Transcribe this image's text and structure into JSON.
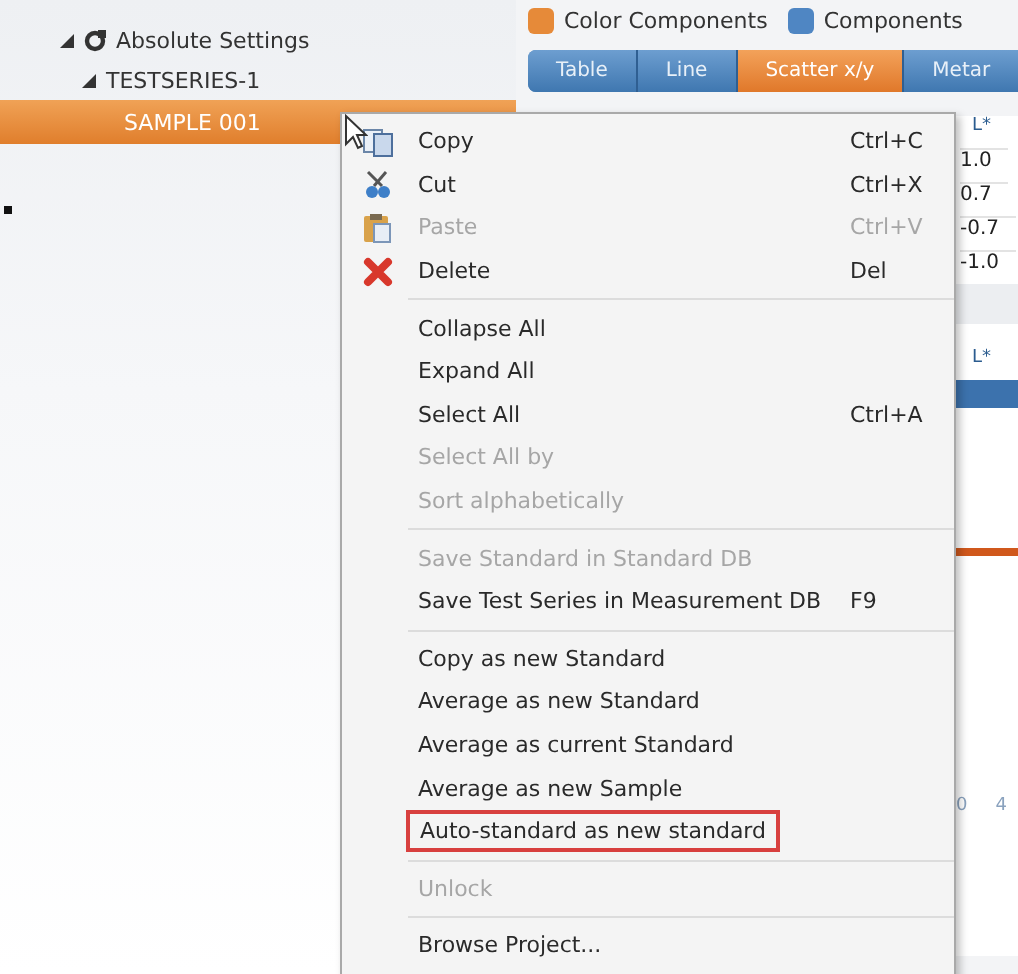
{
  "tree": [
    {
      "label": "Absolute Settings",
      "expanded": true,
      "selected": false,
      "children": [
        {
          "label": "TESTSERIES-1",
          "expanded": true,
          "selected": false,
          "children": [
            {
              "label": "SAMPLE 001",
              "selected": true
            }
          ]
        }
      ]
    }
  ],
  "options": [
    {
      "label": "Color Components",
      "checked": true
    },
    {
      "label": "Components",
      "checked": false
    }
  ],
  "view_tabs": [
    {
      "label": "Table",
      "selected": false
    },
    {
      "label": "Line",
      "selected": false
    },
    {
      "label": "Scatter x/y",
      "selected": true
    },
    {
      "label": "Metar",
      "selected": false
    }
  ],
  "table": {
    "header": "L*",
    "values": [
      "1.0",
      "0.7",
      "-0.7",
      "-1.0"
    ],
    "header_2": "L*"
  },
  "axis_labels": [
    "0",
    "4"
  ],
  "context_menu": [
    {
      "kind": "item",
      "label": "Copy",
      "shortcut": "Ctrl+C",
      "disabled": false
    },
    {
      "kind": "item",
      "label": "Cut",
      "shortcut": "Ctrl+X",
      "disabled": false
    },
    {
      "kind": "item",
      "label": "Paste",
      "shortcut": "Ctrl+V",
      "disabled": true
    },
    {
      "kind": "item",
      "label": "Delete",
      "shortcut": "Del",
      "disabled": false
    },
    {
      "kind": "separator"
    },
    {
      "kind": "item",
      "label": "Collapse All",
      "disabled": false
    },
    {
      "kind": "item",
      "label": "Expand All",
      "disabled": false
    },
    {
      "kind": "item",
      "label": "Select All",
      "shortcut": "Ctrl+A",
      "disabled": false
    },
    {
      "kind": "item",
      "label": "Select All by",
      "disabled": true
    },
    {
      "kind": "item",
      "label": "Sort alphabetically",
      "disabled": true
    },
    {
      "kind": "separator"
    },
    {
      "kind": "item",
      "label": "Save Standard in Standard DB",
      "disabled": true
    },
    {
      "kind": "item",
      "label": "Save Test Series in Measurement DB",
      "shortcut": "F9",
      "disabled": false
    },
    {
      "kind": "separator"
    },
    {
      "kind": "item",
      "label": "Copy as new Standard",
      "disabled": false
    },
    {
      "kind": "item",
      "label": "Average as new Standard",
      "disabled": false
    },
    {
      "kind": "item",
      "label": "Average as current Standard",
      "disabled": false
    },
    {
      "kind": "item",
      "label": "Average as new Sample",
      "disabled": false
    },
    {
      "kind": "item",
      "label": "Auto-standard as new standard",
      "disabled": false,
      "outlined": true
    },
    {
      "kind": "separator"
    },
    {
      "kind": "item",
      "label": "Unlock",
      "disabled": true
    },
    {
      "kind": "separator"
    },
    {
      "kind": "item",
      "label": "Browse Project...",
      "disabled": false
    }
  ]
}
